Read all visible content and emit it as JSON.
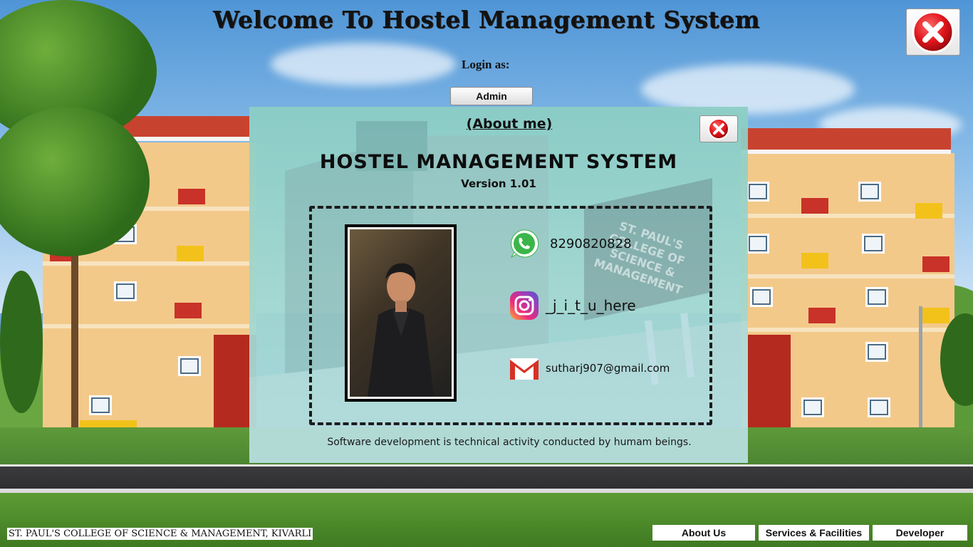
{
  "header": {
    "title": "Welcome To Hostel Management System",
    "login_label": "Login as:",
    "admin_button": "Admin"
  },
  "about_dialog": {
    "heading": "(About me)",
    "app_name": "HOSTEL MANAGEMENT SYSTEM",
    "version": "Version 1.01",
    "sign_text": "ST. PAUL'S COLLEGE OF SCIENCE & MANAGEMENT",
    "contacts": [
      {
        "icon": "whatsapp-icon",
        "value": "8290820828"
      },
      {
        "icon": "instagram-icon",
        "value": "_j_i_t_u_here"
      },
      {
        "icon": "gmail-icon",
        "value": "sutharj907@gmail.com"
      }
    ],
    "quote": "Software development is technical activity conducted by humam beings."
  },
  "footer": {
    "college": "ST. PAUL'S COLLEGE OF SCIENCE & MANAGEMENT, KIVARLI",
    "buttons": [
      "About Us",
      "Services & Facilities",
      "Developer"
    ]
  },
  "colors": {
    "close_red": "#e0161c",
    "whatsapp_green": "#3bb54a",
    "gmail_red": "#d93025",
    "dialog_tint": "#9fd6cc"
  }
}
